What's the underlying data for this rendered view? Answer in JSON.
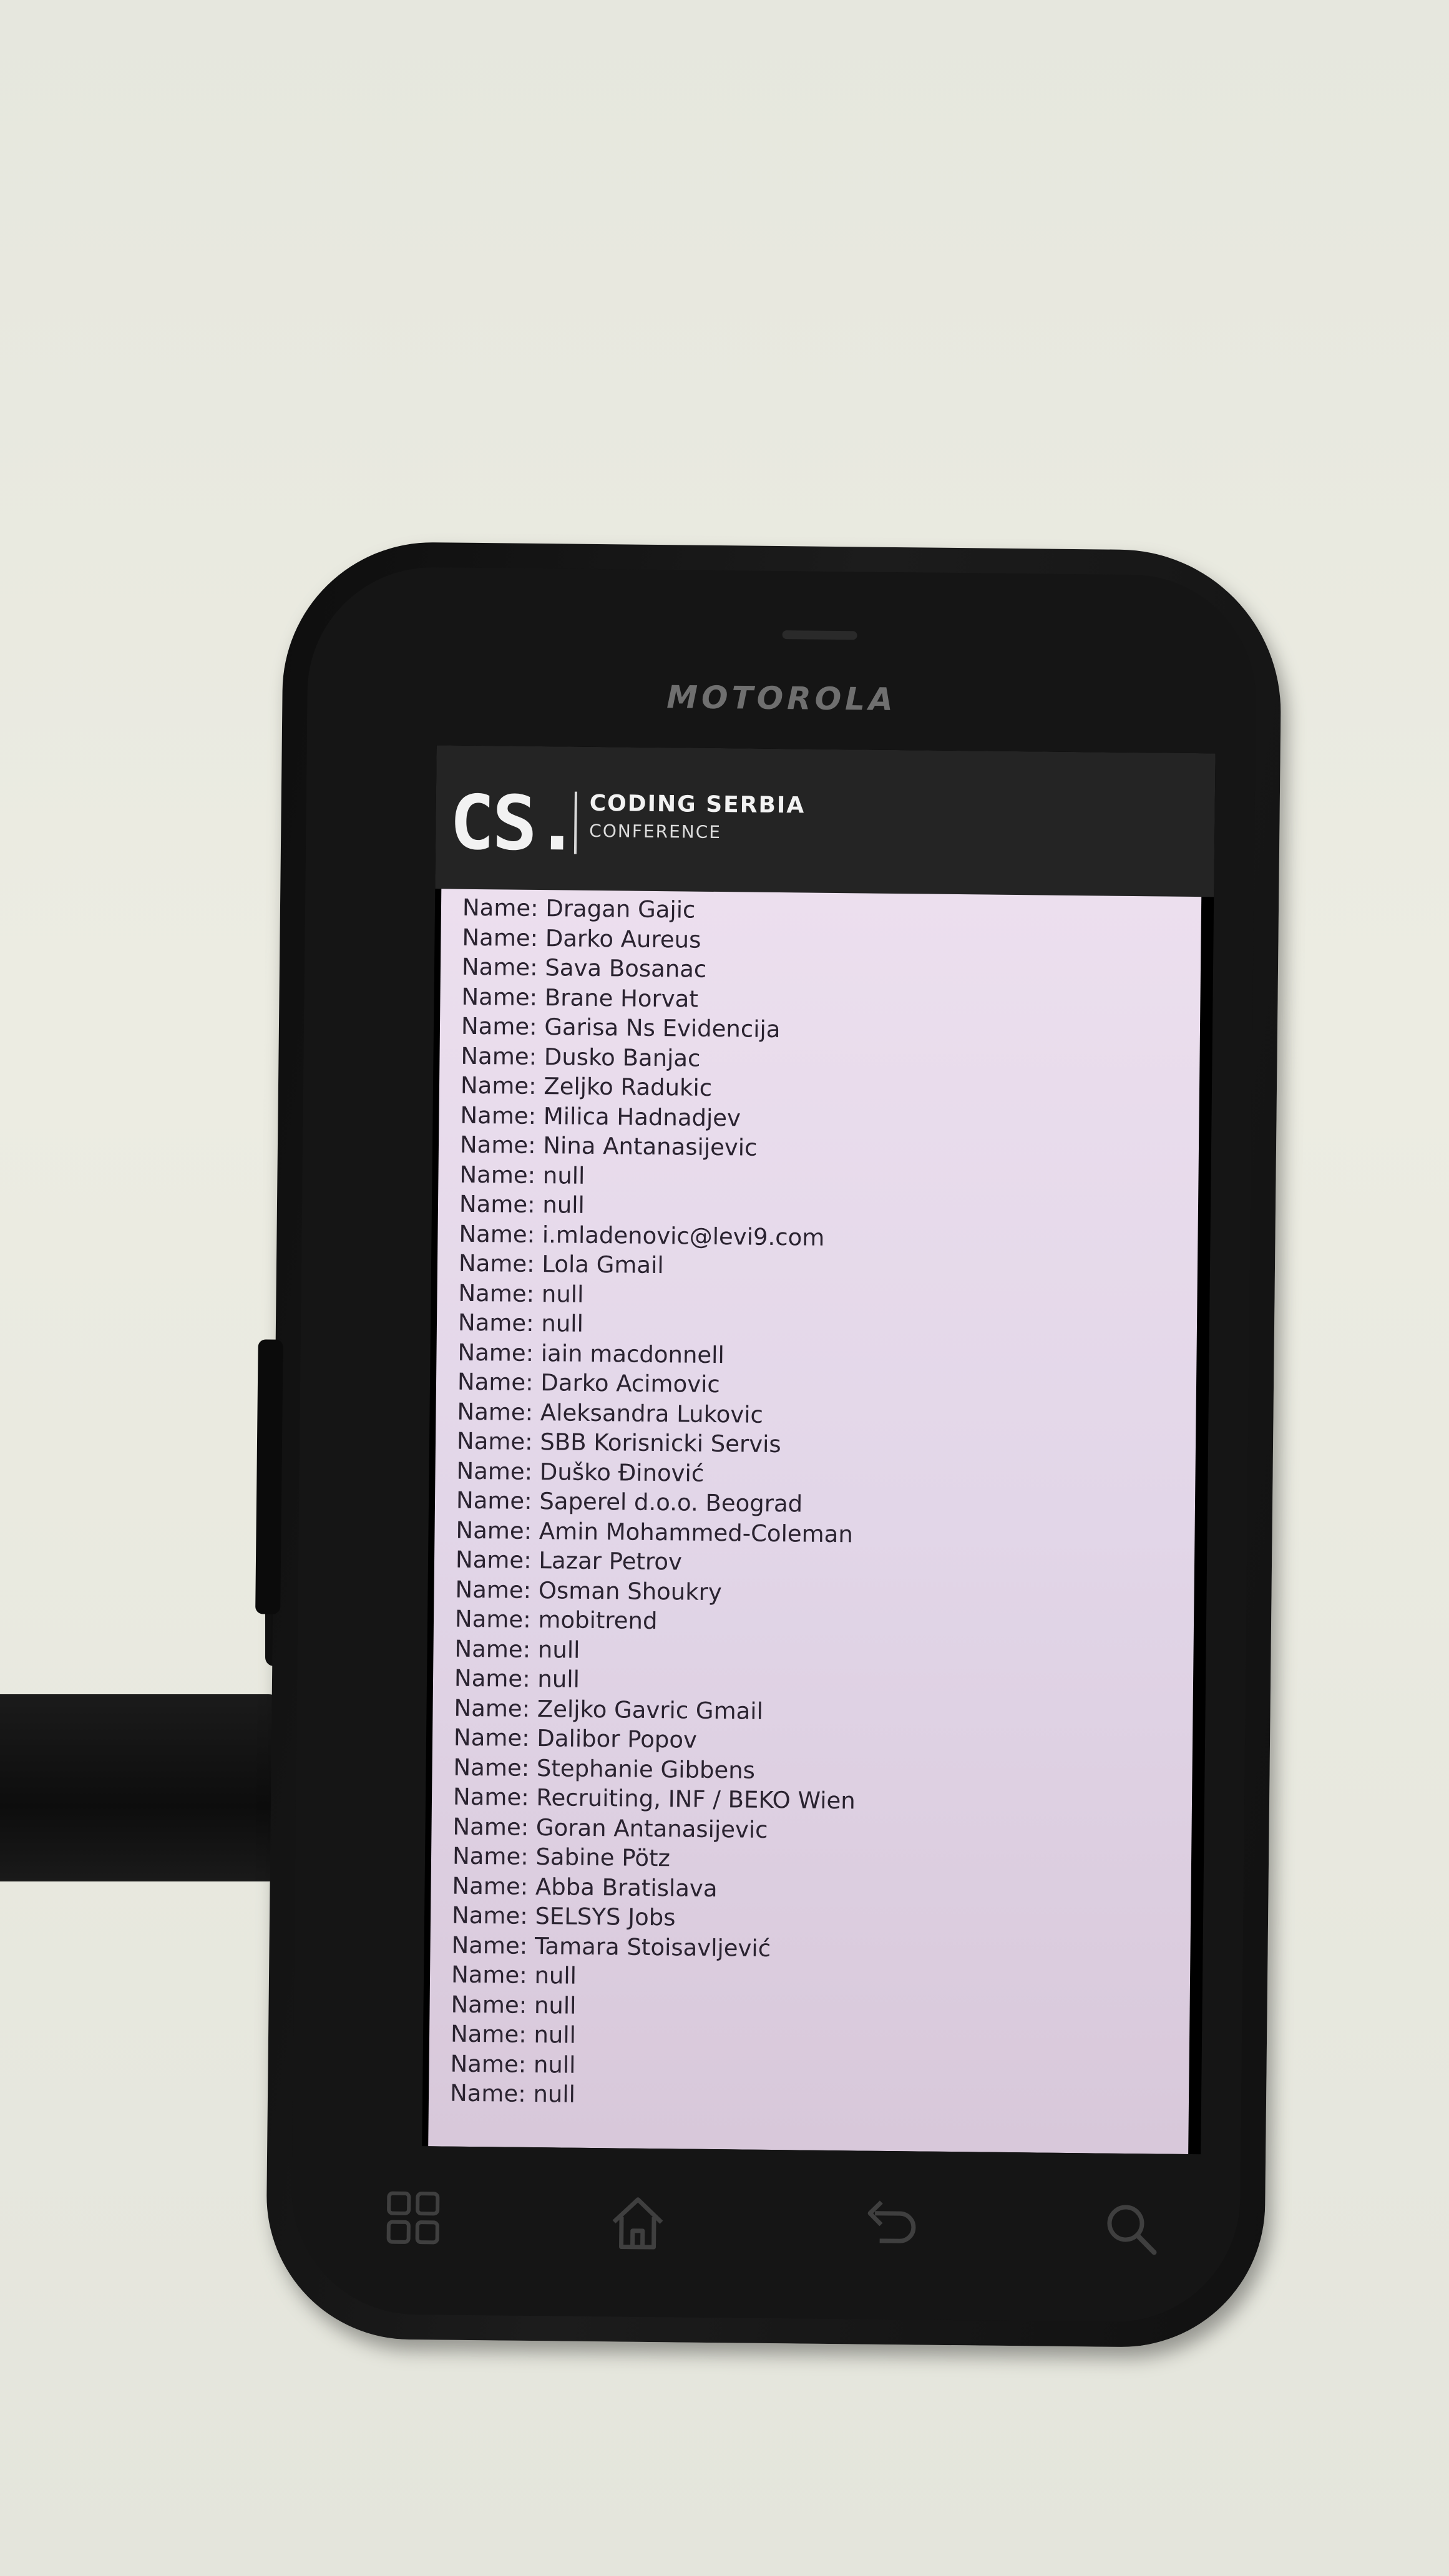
{
  "device": {
    "brand": "MOTOROLA"
  },
  "app_header": {
    "logo_mark": "CS.",
    "title": "CODING SERBIA",
    "subtitle": "CONFERENCE"
  },
  "contacts": [
    "Name: Dragan Gajic",
    "Name: Darko Aureus",
    "Name: Sava Bosanac",
    "Name: Brane Horvat",
    "Name: Garisa Ns Evidencija",
    "Name: Dusko Banjac",
    "Name: Zeljko Radukic",
    "Name: Milica Hadnadjev",
    "Name: Nina Antanasijevic",
    "Name: null",
    "Name: null",
    "Name: i.mladenovic@levi9.com",
    "Name: Lola Gmail",
    "Name: null",
    "Name: null",
    "Name: iain macdonnell",
    "Name: Darko Acimovic",
    "Name: Aleksandra Lukovic",
    "Name: SBB Korisnicki Servis",
    "Name: Duško Đinović",
    "Name: Saperel d.o.o. Beograd",
    "Name: Amin Mohammed-Coleman",
    "Name: Lazar Petrov",
    "Name: Osman Shoukry",
    "Name: mobitrend",
    "Name: null",
    "Name: null",
    "Name: Zeljko Gavric Gmail",
    "Name: Dalibor Popov",
    "Name: Stephanie Gibbens",
    "Name: Recruiting, INF / BEKO Wien",
    "Name: Goran Antanasijevic",
    "Name: Sabine Pötz",
    "Name: Abba Bratislava",
    "Name: SELSYS Jobs",
    "Name: Tamara Stoisavljević",
    "Name: null",
    "Name: null",
    "Name: null",
    "Name: null",
    "Name: null"
  ],
  "nav_keys": {
    "menu": "menu-icon",
    "home": "home-icon",
    "back": "back-icon",
    "search": "search-icon"
  }
}
